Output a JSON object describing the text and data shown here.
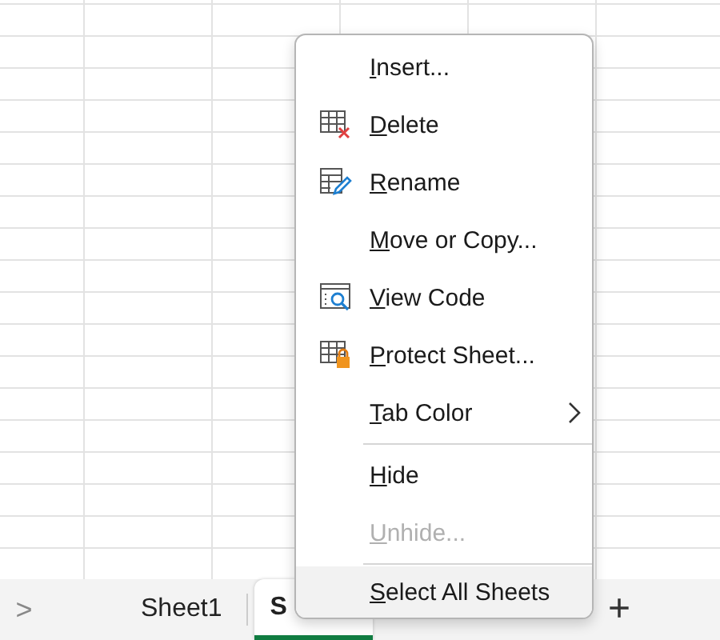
{
  "context_menu": {
    "items": [
      {
        "kind": "plain",
        "label": "Insert...",
        "disabled": false,
        "submenu": false,
        "selected": false
      },
      {
        "kind": "delete",
        "label": "Delete",
        "disabled": false,
        "submenu": false,
        "selected": false
      },
      {
        "kind": "rename",
        "label": "Rename",
        "disabled": false,
        "submenu": false,
        "selected": false
      },
      {
        "kind": "plain",
        "label": "Move or Copy...",
        "disabled": false,
        "submenu": false,
        "selected": false
      },
      {
        "kind": "code",
        "label": "View Code",
        "disabled": false,
        "submenu": false,
        "selected": false
      },
      {
        "kind": "protect",
        "label": "Protect Sheet...",
        "disabled": false,
        "submenu": false,
        "selected": false
      },
      {
        "kind": "plain",
        "label": "Tab Color",
        "disabled": false,
        "submenu": true,
        "selected": false
      },
      {
        "kind": "separator"
      },
      {
        "kind": "plain",
        "label": "Hide",
        "disabled": false,
        "submenu": false,
        "selected": false
      },
      {
        "kind": "plain",
        "label": "Unhide...",
        "disabled": true,
        "submenu": false,
        "selected": false
      },
      {
        "kind": "separator"
      },
      {
        "kind": "plain",
        "label": "Select All Sheets",
        "disabled": false,
        "submenu": false,
        "selected": true
      }
    ]
  },
  "sheet_tabs": {
    "scroll_arrow": ">",
    "add_button": "+",
    "tabs": [
      {
        "label": "Sheet1",
        "selected": false
      },
      {
        "label": "S",
        "selected": true
      }
    ]
  }
}
